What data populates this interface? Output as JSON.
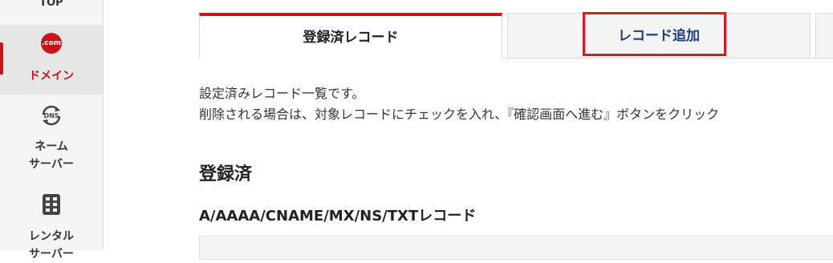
{
  "sidebar": {
    "items": [
      {
        "label": "TOP"
      },
      {
        "label": "ドメイン",
        "icon_text": ".com"
      },
      {
        "label": "ネーム\nサーバー",
        "icon_text": "DNS"
      },
      {
        "label": "レンタル\nサーバー"
      }
    ],
    "active_color": "#c4161c"
  },
  "tabs": [
    {
      "label": "登録済レコード",
      "active": true
    },
    {
      "label": "レコード追加",
      "active": false
    }
  ],
  "main": {
    "description": [
      "設定済みレコード一覧です。",
      "削除される場合は、対象レコードにチェックを入れ、『確認画面へ進む』ボタンをクリック"
    ],
    "section_title": "登録済",
    "record_types_heading": "A/AAAA/CNAME/MX/NS/TXTレコード"
  },
  "colors": {
    "accent_red": "#c4161c",
    "highlight_red": "#d71920",
    "tab_link_blue": "#1f3d7a"
  }
}
